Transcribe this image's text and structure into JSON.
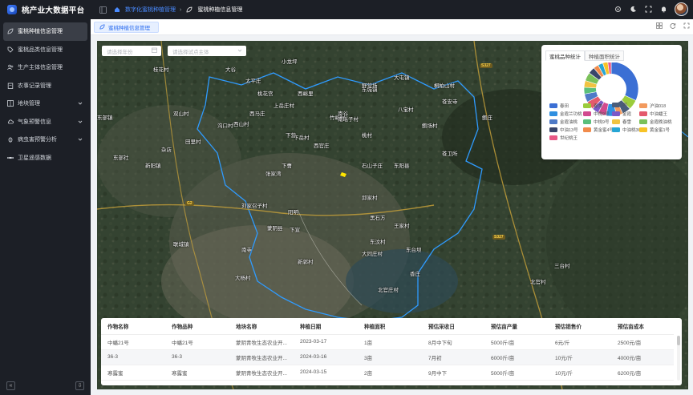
{
  "app": {
    "title": "桃产业大数据平台"
  },
  "sidebar": {
    "items": [
      {
        "label": "蜜桃种植信息管理",
        "icon": "leaf-icon",
        "active": true,
        "has_children": false
      },
      {
        "label": "蜜桃品类信息管理",
        "icon": "tag-icon",
        "active": false,
        "has_children": false
      },
      {
        "label": "生产主体信息管理",
        "icon": "users-icon",
        "active": false,
        "has_children": false
      },
      {
        "label": "农事记录管理",
        "icon": "clipboard-icon",
        "active": false,
        "has_children": false
      },
      {
        "label": "地块管理",
        "icon": "grid-icon",
        "active": false,
        "has_children": true
      },
      {
        "label": "气象预警信息",
        "icon": "cloud-icon",
        "active": false,
        "has_children": true
      },
      {
        "label": "病虫害预警分析",
        "icon": "bug-icon",
        "active": false,
        "has_children": true
      },
      {
        "label": "卫星遥感数据",
        "icon": "satellite-icon",
        "active": false,
        "has_children": false
      }
    ]
  },
  "header": {
    "breadcrumb": {
      "parent": "数字化蜜桃种植管理",
      "current": "蜜桃种植信息管理"
    }
  },
  "tabs": [
    {
      "label": "蜜桃种植信息管理"
    }
  ],
  "filters": {
    "date_placeholder": "请选择年份",
    "entity_placeholder": "请选择试点主体"
  },
  "map": {
    "labels": [
      "桂花村",
      "小龙坪",
      "太平庄",
      "大谷",
      "桃花宫",
      "西峪里",
      "东城镇",
      "大屯镇",
      "桐柏山村",
      "上岳庄村",
      "南谷",
      "西马庄",
      "沟口村",
      "双山村",
      "东部镇",
      "下营",
      "竹峪村",
      "野营场",
      "八宝村",
      "苍安寺",
      "鲍场村",
      "西山村",
      "下岳村",
      "田里村",
      "南瑶子村",
      "西官庄",
      "桃村",
      "东部社",
      "杂店",
      "鲍庄",
      "苍卫所",
      "新阳镇",
      "东阳县",
      "下曹",
      "石山子庄",
      "邱家村",
      "王家村",
      "张家湾",
      "阳明",
      "蒙阴县",
      "下宣",
      "黑石方",
      "刘家召子村",
      "联城镇",
      "南寺",
      "大杨村",
      "东汶村",
      "东台坝",
      "香庄",
      "新郭村",
      "大同庄村",
      "北官庄村",
      "北官村",
      "三台村"
    ],
    "roads": [
      "S327",
      "G2",
      "S327"
    ]
  },
  "chart_panel": {
    "tabs": [
      "蜜桃品种统计",
      "种植面积统计"
    ],
    "active_tab": 0,
    "legend": [
      {
        "name": "春田",
        "color": "#3b6fd4"
      },
      {
        "name": "春美",
        "color": "#9bcc3c"
      },
      {
        "name": "36",
        "color": "#4a5d7a"
      },
      {
        "name": "沪油018",
        "color": "#f29a5e"
      },
      {
        "name": "金霞兰功桃",
        "color": "#2f8fe0"
      },
      {
        "name": "中桃9号",
        "color": "#d24a8f"
      },
      {
        "name": "金霞",
        "color": "#7a58c7"
      },
      {
        "name": "中油蟠王",
        "color": "#e45a6c"
      },
      {
        "name": "金霞油桃",
        "color": "#4f7ac7"
      },
      {
        "name": "中桃9号",
        "color": "#5abf7b"
      },
      {
        "name": "春雪",
        "color": "#f0c341"
      },
      {
        "name": "金霞晚油桃",
        "color": "#7bc15a"
      },
      {
        "name": "中油13号",
        "color": "#39456b"
      },
      {
        "name": "黄金蜜4号",
        "color": "#f18b4b"
      },
      {
        "name": "中油桃36-5",
        "color": "#26a5d4"
      },
      {
        "name": "黄金蜜1号",
        "color": "#f7c326"
      },
      {
        "name": "世纪桃王",
        "color": "#e85886"
      }
    ]
  },
  "chart_data": {
    "type": "pie",
    "title": "",
    "series": [
      {
        "values": [
          32,
          6,
          5,
          4,
          6,
          5,
          4,
          5,
          5,
          4,
          4,
          5,
          4,
          3,
          3,
          3,
          2
        ]
      }
    ],
    "categories": [
      "春田",
      "春美",
      "36",
      "沪油018",
      "金霞兰功桃",
      "中桃9号",
      "金霞",
      "中油蟠王",
      "金霞油桃",
      "中桃9号",
      "春雪",
      "金霞晚油桃",
      "中油13号",
      "黄金蜜4号",
      "中油桃36-5",
      "黄金蜜1号",
      "世纪桃王"
    ],
    "inner_radius_ratio": 0.55
  },
  "table": {
    "columns": [
      "作物名称",
      "作物品种",
      "地块名称",
      "种植日期",
      "种植面积",
      "预估采收日",
      "预估亩产量",
      "预估销售价",
      "预估亩成本"
    ],
    "rows": [
      [
        "中蟠21号",
        "中蟠21号",
        "蒙阴青牧生态农业开...",
        "2023-03-17",
        "1亩",
        "8月中下旬",
        "5000斤/亩",
        "6元/斤",
        "2500元/亩"
      ],
      [
        "36-3",
        "36-3",
        "蒙阴青牧生态农业开...",
        "2024-03-16",
        "3亩",
        "7月初",
        "6000斤/亩",
        "10元/斤",
        "4000元/亩"
      ],
      [
        "寒露蜜",
        "寒露蜜",
        "蒙阴青牧生态农业开...",
        "2024-03-15",
        "2亩",
        "9月中下",
        "5000斤/亩",
        "10元/斤",
        "6200元/亩"
      ]
    ]
  }
}
